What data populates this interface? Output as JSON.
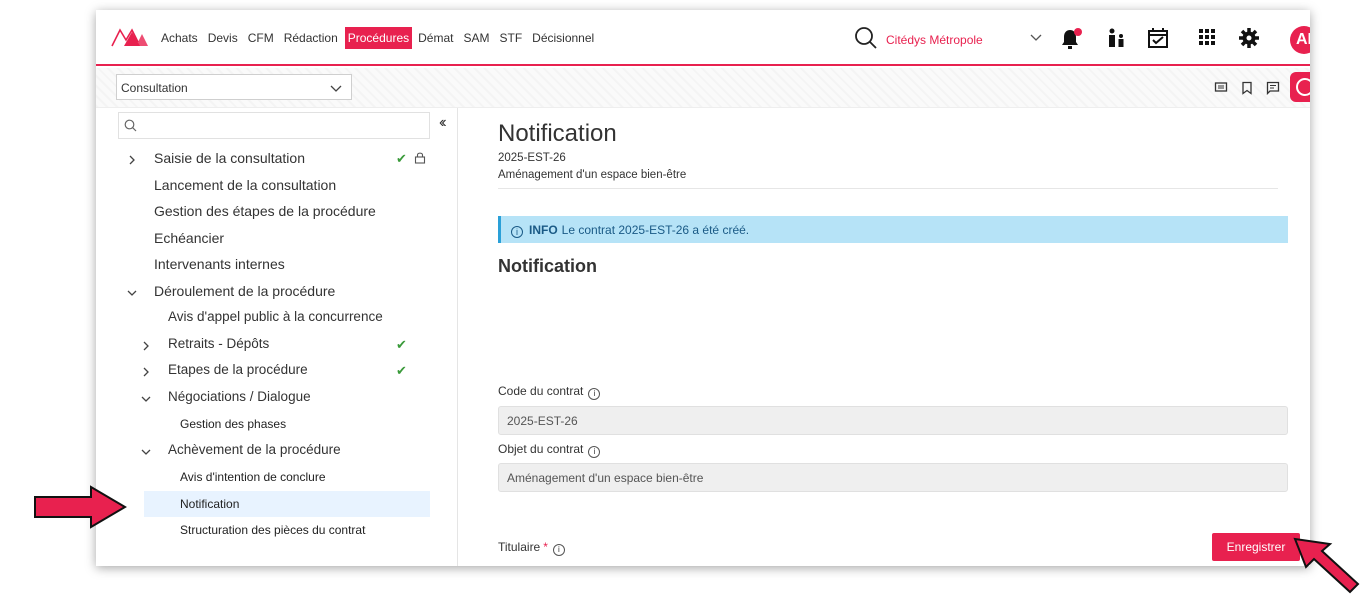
{
  "nav": {
    "items": [
      "Achats",
      "Devis",
      "CFM",
      "Rédaction",
      "Procédures",
      "Démat",
      "SAM",
      "STF",
      "Décisionnel"
    ],
    "active": "Procédures",
    "organization": "Citédys Métropole",
    "avatar_initials": "AE"
  },
  "subbar": {
    "select_value": "Consultation"
  },
  "sidebar": {
    "items": [
      {
        "label": "Saisie de la consultation",
        "level": 1,
        "expander": "collapsed",
        "check": true,
        "lock": true
      },
      {
        "label": "Lancement de la consultation",
        "level": 1,
        "expander": "none"
      },
      {
        "label": "Gestion des étapes de la procédure",
        "level": 1,
        "expander": "none"
      },
      {
        "label": "Echéancier",
        "level": 1,
        "expander": "none"
      },
      {
        "label": "Intervenants internes",
        "level": 1,
        "expander": "none"
      },
      {
        "label": "Déroulement de la procédure",
        "level": 1,
        "expander": "expanded"
      },
      {
        "label": "Avis d'appel public à la concurrence",
        "level": 2,
        "expander": "none"
      },
      {
        "label": "Retraits - Dépôts",
        "level": 2,
        "expander": "collapsed",
        "check": true
      },
      {
        "label": "Etapes de la procédure",
        "level": 2,
        "expander": "collapsed",
        "check": true
      },
      {
        "label": "Négociations / Dialogue",
        "level": 2,
        "expander": "expanded"
      },
      {
        "label": "Gestion des phases",
        "level": 3,
        "expander": "none"
      },
      {
        "label": "Achèvement de la procédure",
        "level": 2,
        "expander": "expanded"
      },
      {
        "label": "Avis d'intention de conclure",
        "level": 3,
        "expander": "none"
      },
      {
        "label": "Notification",
        "level": 3,
        "expander": "none",
        "selected": true
      },
      {
        "label": "Structuration des pièces du contrat",
        "level": 3,
        "expander": "none"
      }
    ]
  },
  "main": {
    "title": "Notification",
    "code": "2025-EST-26",
    "object": "Aménagement d'un espace bien-être",
    "info_tag": "INFO",
    "info_text": "Le contrat 2025-EST-26 a été créé.",
    "section_title": "Notification",
    "code_label": "Code du contrat",
    "code_value": "2025-EST-26",
    "object_label": "Objet du contrat",
    "object_value": "Aménagement d'un espace bien-être",
    "holder_label": "Titulaire",
    "required_mark": "*",
    "save_label": "Enregistrer"
  },
  "colors": {
    "brand": "#e8214f",
    "info_bg": "#b6e3f7",
    "check": "#3a9a3a"
  }
}
